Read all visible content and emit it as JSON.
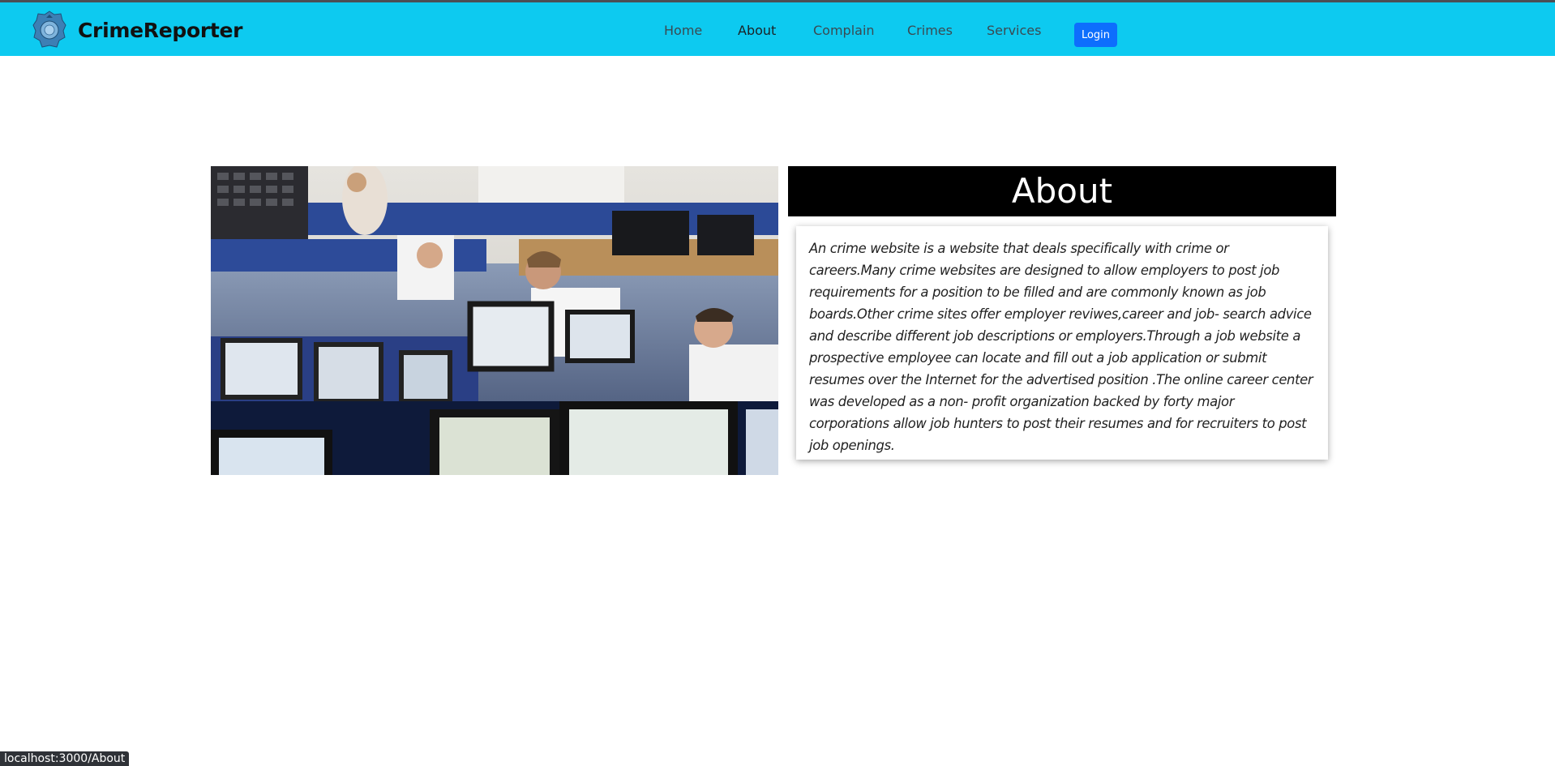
{
  "brand": {
    "name": "CrimeReporter",
    "logo_icon": "police-badge-icon"
  },
  "nav": {
    "items": [
      {
        "label": "Home"
      },
      {
        "label": "About"
      },
      {
        "label": "Complain"
      },
      {
        "label": "Crimes"
      },
      {
        "label": "Services"
      }
    ],
    "active": "About",
    "login_label": "Login"
  },
  "hero_image": {
    "alt": "Police call center operators at computer workstations"
  },
  "about": {
    "title": "About",
    "body": "An crime website is a website that deals specifically with crime or careers.Many crime websites are designed to allow employers to post job requirements for a position to be filled and are commonly known as job boards.Other crime sites offer employer reviwes,career and job- search advice and describe different job descriptions or employers.Through a job website a prospective employee can locate and fill out a job application or submit resumes over the Internet for the advertised position .The online career center was developed as a non- profit organization backed by forty major corporations allow job hunters to post their resumes and for recruiters to post job openings."
  },
  "status_bar": {
    "url": "localhost:3000/About"
  },
  "colors": {
    "navbar": "#0dcaf0",
    "login_button": "#0d6efd",
    "about_header_bg": "#000000"
  }
}
